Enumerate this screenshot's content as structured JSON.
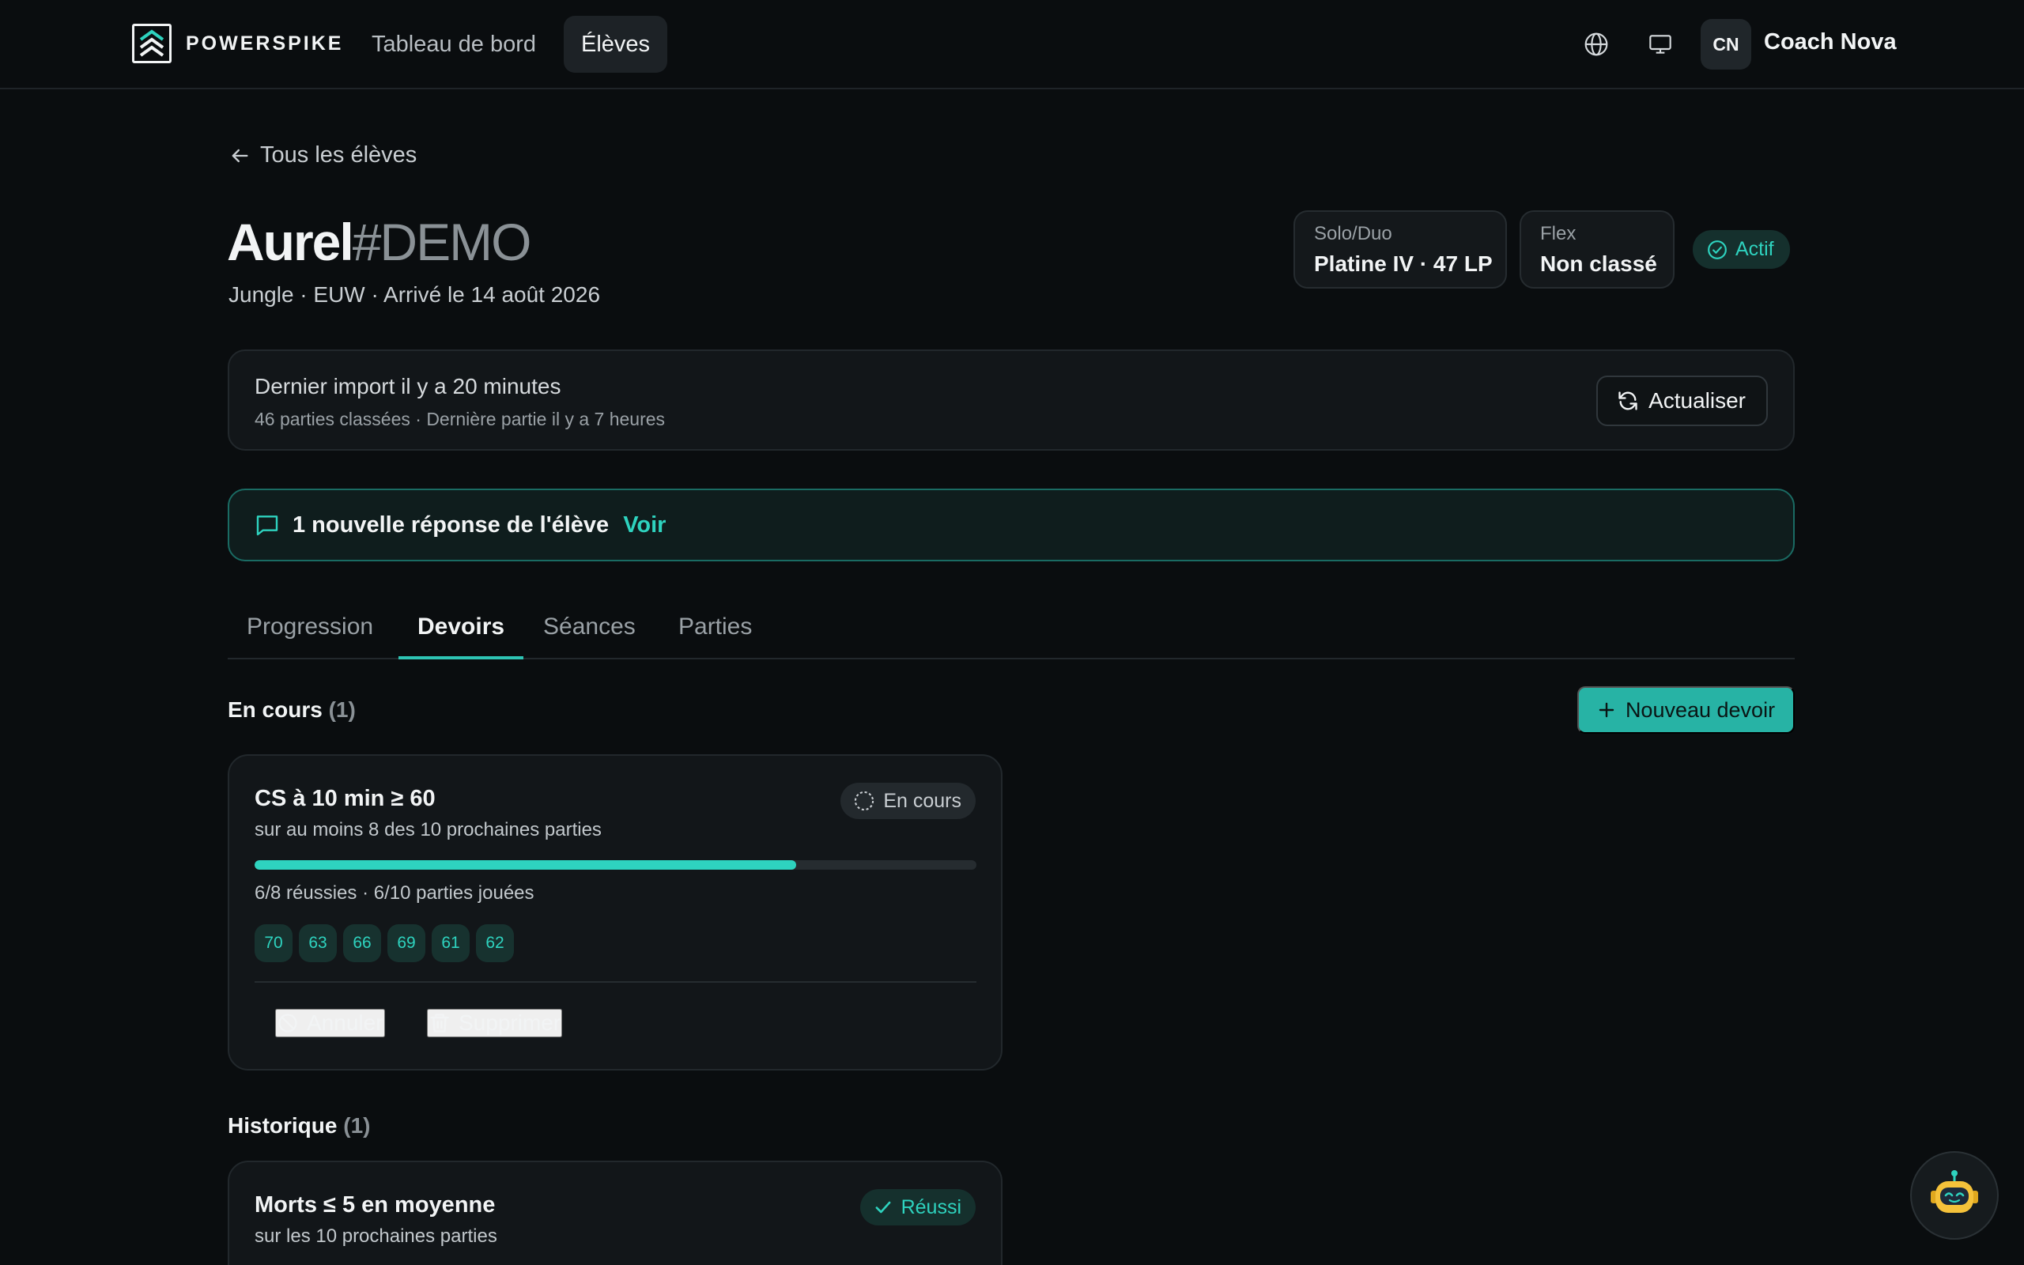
{
  "brand": {
    "name": "POWERSPIKE"
  },
  "nav": {
    "dashboard": "Tableau de bord",
    "students": "Élèves"
  },
  "user": {
    "initials": "CN",
    "name": "Coach Nova"
  },
  "icons": [
    "logo-icon",
    "globe-icon",
    "monitor-icon",
    "arrow-left-icon",
    "check-circle-icon",
    "refresh-icon",
    "message-icon",
    "plus-icon",
    "spinner-icon",
    "ban-icon",
    "trash-icon",
    "check-icon",
    "robot-icon"
  ],
  "colors": {
    "accent": "#2ed3bf",
    "button": "#27b3a5",
    "background": "#0a0d0f"
  },
  "back": {
    "label": "Tous les élèves"
  },
  "player": {
    "name": "Aurel",
    "tag": "#DEMO",
    "subtitle": "Jungle · EUW · Arrivé le 14 août 2026",
    "ranks": [
      {
        "queue": "Solo/Duo",
        "value": "Platine IV · 47 LP"
      },
      {
        "queue": "Flex",
        "value": "Non classé"
      }
    ],
    "status": "Actif"
  },
  "import": {
    "title": "Dernier import il y a 20 minutes",
    "subtitle": "46 parties classées · Dernière partie il y a 7 heures",
    "refresh_label": "Actualiser"
  },
  "reply": {
    "text": "1 nouvelle réponse de l'élève",
    "link": "Voir"
  },
  "tabs": [
    "Progression",
    "Devoirs",
    "Séances",
    "Parties"
  ],
  "active_tab": "Devoirs",
  "in_progress": {
    "title": "En cours",
    "count": "(1)",
    "new_button": "Nouveau devoir",
    "task": {
      "title": "CS à 10 min ≥ 60",
      "subtitle": "sur au moins 8 des 10 prochaines parties",
      "status": "En cours",
      "progress": 0.75,
      "progress_text": "6/8 réussies · 6/10 parties jouées",
      "values": [
        "70",
        "63",
        "66",
        "69",
        "61",
        "62"
      ],
      "cancel_label": "Annuler",
      "delete_label": "Supprimer"
    }
  },
  "history": {
    "title": "Historique",
    "count": "(1)",
    "task": {
      "title": "Morts ≤ 5 en moyenne",
      "subtitle": "sur les 10 prochaines parties",
      "status": "Réussi"
    }
  }
}
